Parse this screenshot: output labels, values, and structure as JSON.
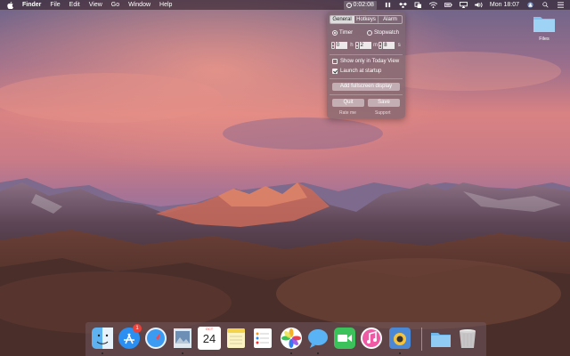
{
  "menubar": {
    "app_name": "Finder",
    "menus": [
      "File",
      "Edit",
      "View",
      "Go",
      "Window",
      "Help"
    ],
    "timer_display": "0:02:08",
    "clock": "Mon 18:07",
    "status_icons": [
      "timer-icon",
      "pause-icon",
      "dropbox-icon",
      "copy-icon",
      "wifi-icon",
      "battery-icon",
      "airplay-icon",
      "volume-icon",
      "user-avatar-icon",
      "search-icon",
      "list-icon"
    ]
  },
  "popover": {
    "tabs": [
      "General",
      "Hotkeys",
      "Alarm"
    ],
    "active_tab": "General",
    "mode_timer": "Timer",
    "mode_stopwatch": "Stopwatch",
    "selected_mode": "Timer",
    "hours": "0",
    "hours_unit": "h",
    "minutes": "2",
    "minutes_unit": "m",
    "seconds": "8",
    "seconds_unit": "s",
    "show_today_view_label": "Show only in Today View",
    "show_today_view_checked": false,
    "launch_startup_label": "Launch at startup",
    "launch_startup_checked": true,
    "fullscreen_button": "Add fullscreen display",
    "quit_button": "Quit",
    "save_button": "Save",
    "rate_link": "Rate me",
    "support_link": "Support"
  },
  "desktop": {
    "folder_label": "Files"
  },
  "dock": {
    "apps": [
      "Finder",
      "App Store",
      "Safari",
      "Preview",
      "Calendar",
      "Notes",
      "Reminders",
      "Photos",
      "Messages",
      "FaceTime",
      "iTunes",
      "Screenshot"
    ],
    "app_store_badge": "1",
    "calendar_month": "OCT",
    "calendar_day": "24",
    "trailing": [
      "Downloads",
      "Trash"
    ]
  },
  "colors": {
    "sky_top": "#6f6a8f",
    "sky_pink": "#e98a86",
    "mountain": "#5a3a3f",
    "dock_badge": "#e8423a"
  }
}
